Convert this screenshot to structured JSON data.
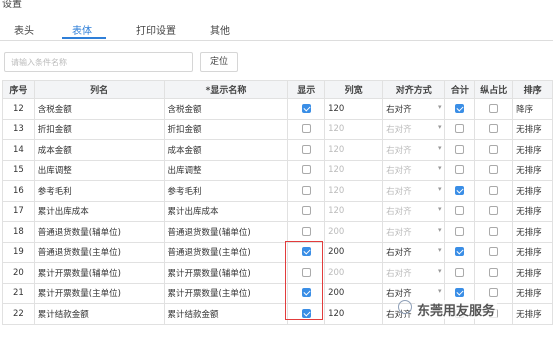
{
  "window": {
    "title": "设置"
  },
  "tabs": [
    {
      "label": "表头",
      "active": false
    },
    {
      "label": "表体",
      "active": true
    },
    {
      "label": "打印设置",
      "active": false
    },
    {
      "label": "其他",
      "active": false
    }
  ],
  "search": {
    "placeholder": "请输入条件名称",
    "button": "定位"
  },
  "table": {
    "headers": [
      "序号",
      "列名",
      "*显示名称",
      "显示",
      "列宽",
      "对齐方式",
      "合计",
      "纵占比",
      "排序"
    ],
    "rows": [
      {
        "no": "12",
        "name": "含税金额",
        "display": "含税金额",
        "show": true,
        "width": "120",
        "align": "右对齐",
        "sum": true,
        "ratio": false,
        "sort": "降序"
      },
      {
        "no": "13",
        "name": "折扣金额",
        "display": "折扣金额",
        "show": false,
        "width": "120",
        "align": "右对齐",
        "sum": false,
        "ratio": false,
        "sort": "无排序"
      },
      {
        "no": "14",
        "name": "成本金额",
        "display": "成本金额",
        "show": false,
        "width": "120",
        "align": "右对齐",
        "sum": false,
        "ratio": false,
        "sort": "无排序"
      },
      {
        "no": "15",
        "name": "出库调整",
        "display": "出库调整",
        "show": false,
        "width": "120",
        "align": "右对齐",
        "sum": false,
        "ratio": false,
        "sort": "无排序"
      },
      {
        "no": "16",
        "name": "参考毛利",
        "display": "参考毛利",
        "show": false,
        "width": "120",
        "align": "右对齐",
        "sum": true,
        "ratio": false,
        "sort": "无排序"
      },
      {
        "no": "17",
        "name": "累计出库成本",
        "display": "累计出库成本",
        "show": false,
        "width": "120",
        "align": "右对齐",
        "sum": false,
        "ratio": false,
        "sort": "无排序"
      },
      {
        "no": "18",
        "name": "普通退货数量(辅单位)",
        "display": "普通退货数量(辅单位)",
        "show": false,
        "width": "200",
        "align": "右对齐",
        "sum": false,
        "ratio": false,
        "sort": "无排序"
      },
      {
        "no": "19",
        "name": "普通退货数量(主单位)",
        "display": "普通退货数量(主单位)",
        "show": true,
        "width": "200",
        "align": "右对齐",
        "sum": true,
        "ratio": false,
        "sort": "无排序"
      },
      {
        "no": "20",
        "name": "累计开票数量(辅单位)",
        "display": "累计开票数量(辅单位)",
        "show": false,
        "width": "200",
        "align": "右对齐",
        "sum": false,
        "ratio": false,
        "sort": "无排序"
      },
      {
        "no": "21",
        "name": "累计开票数量(主单位)",
        "display": "累计开票数量(主单位)",
        "show": true,
        "width": "200",
        "align": "右对齐",
        "sum": true,
        "ratio": false,
        "sort": "无排序"
      },
      {
        "no": "22",
        "name": "累计结款金额",
        "display": "累计结款金额",
        "show": true,
        "width": "120",
        "align": "右对齐",
        "sum": false,
        "ratio": false,
        "sort": "无排序"
      }
    ]
  },
  "watermark": {
    "text": "东莞用友服务"
  }
}
